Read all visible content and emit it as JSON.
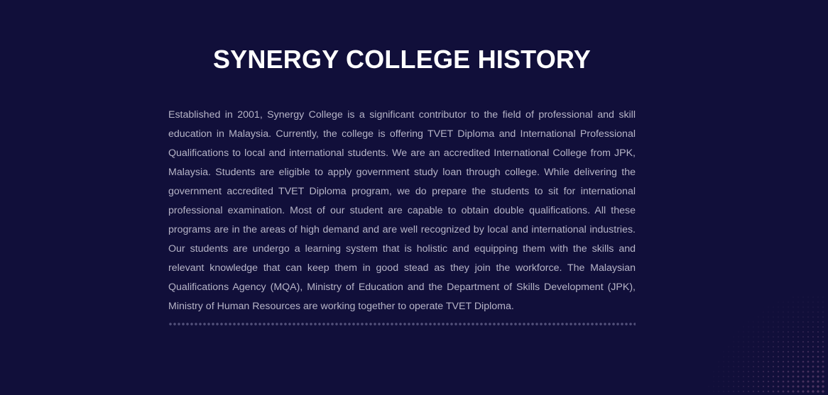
{
  "history": {
    "title": "SYNERGY COLLEGE HISTORY",
    "body": "Established in 2001, Synergy College is a significant contributor to the field of professional and skill education in Malaysia. Currently, the college is offering TVET Diploma and International Professional Qualifications to local and international students. We are an accredited International College from JPK, Malaysia. Students are eligible to apply government study loan through college. While delivering the government accredited TVET Diploma program, we do prepare the students to sit for international professional examination. Most of our student are capable to obtain double qualifications. All these programs are in the areas of high demand and are well recognized by local and international industries. Our students are undergo a learning system that is holistic and equipping them with the skills and relevant knowledge that can keep them in good stead as they join the workforce. The Malaysian Qualifications Agency (MQA), Ministry of Education and the Department of Skills Development (JPK), Ministry of Human Resources are working together to operate TVET Diploma."
  },
  "colors": {
    "background": "#110f3a",
    "title": "#ffffff",
    "body_text": "#b6b4c7",
    "divider_dots": "#52507a",
    "corner_dots": "#6e4a78"
  }
}
